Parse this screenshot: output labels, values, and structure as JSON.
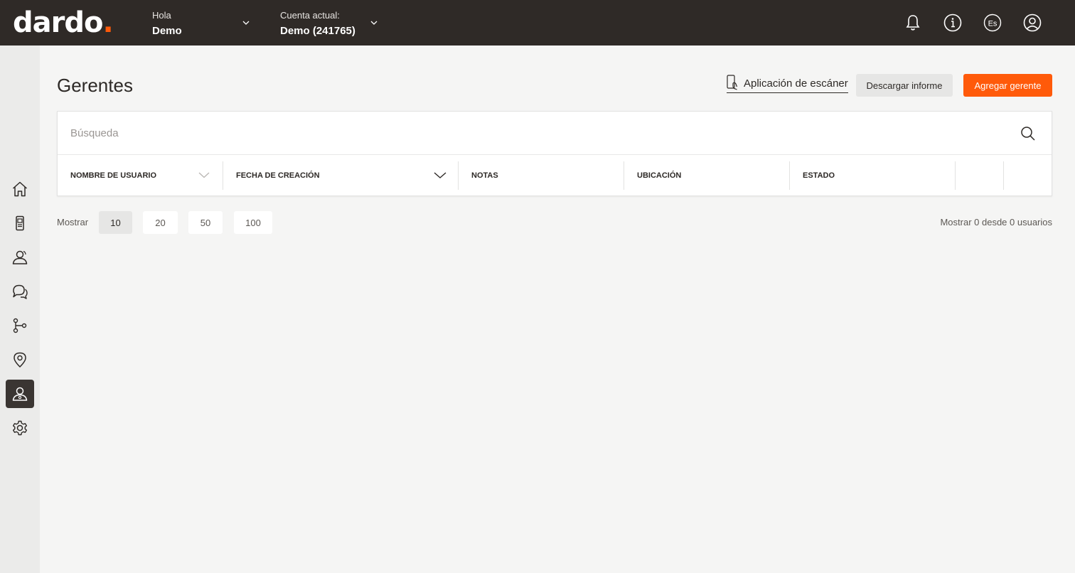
{
  "header": {
    "logo_text": "dardo",
    "logo_dot": ".",
    "greeting_label": "Hola",
    "user_name": "Demo",
    "account_label": "Cuenta actual:",
    "account_name": "Demo (241765)",
    "language": "Es",
    "accent_color": "#ff5a0a",
    "icons": [
      "bell-icon",
      "info-icon",
      "language-icon",
      "user-account-icon"
    ]
  },
  "sidebar": {
    "items": [
      {
        "name": "home",
        "icon": "home-icon",
        "active": false
      },
      {
        "name": "devices",
        "icon": "device-icon",
        "active": false
      },
      {
        "name": "contacts",
        "icon": "contacts-icon",
        "active": false
      },
      {
        "name": "messages",
        "icon": "chat-icon",
        "active": false
      },
      {
        "name": "workflows",
        "icon": "workflow-icon",
        "active": false
      },
      {
        "name": "locations",
        "icon": "location-pin-icon",
        "active": false
      },
      {
        "name": "managers",
        "icon": "manager-icon",
        "active": true
      },
      {
        "name": "settings",
        "icon": "gear-icon",
        "active": false
      }
    ]
  },
  "main": {
    "title": "Gerentes",
    "scanner_link": "Aplicación de escáner",
    "download_button": "Descargar informe",
    "add_button": "Agregar gerente",
    "search": {
      "placeholder": "Búsqueda",
      "value": ""
    },
    "columns": [
      "NOMBRE DE USUARIO",
      "FECHA DE CREACIÓN",
      "NOTAS",
      "UBICACIÓN",
      "ESTADO"
    ],
    "rows": []
  },
  "pagination": {
    "show_label": "Mostrar",
    "options": [
      "10",
      "20",
      "50",
      "100"
    ],
    "selected": "10",
    "summary": "Mostrar 0 desde 0 usuarios"
  }
}
